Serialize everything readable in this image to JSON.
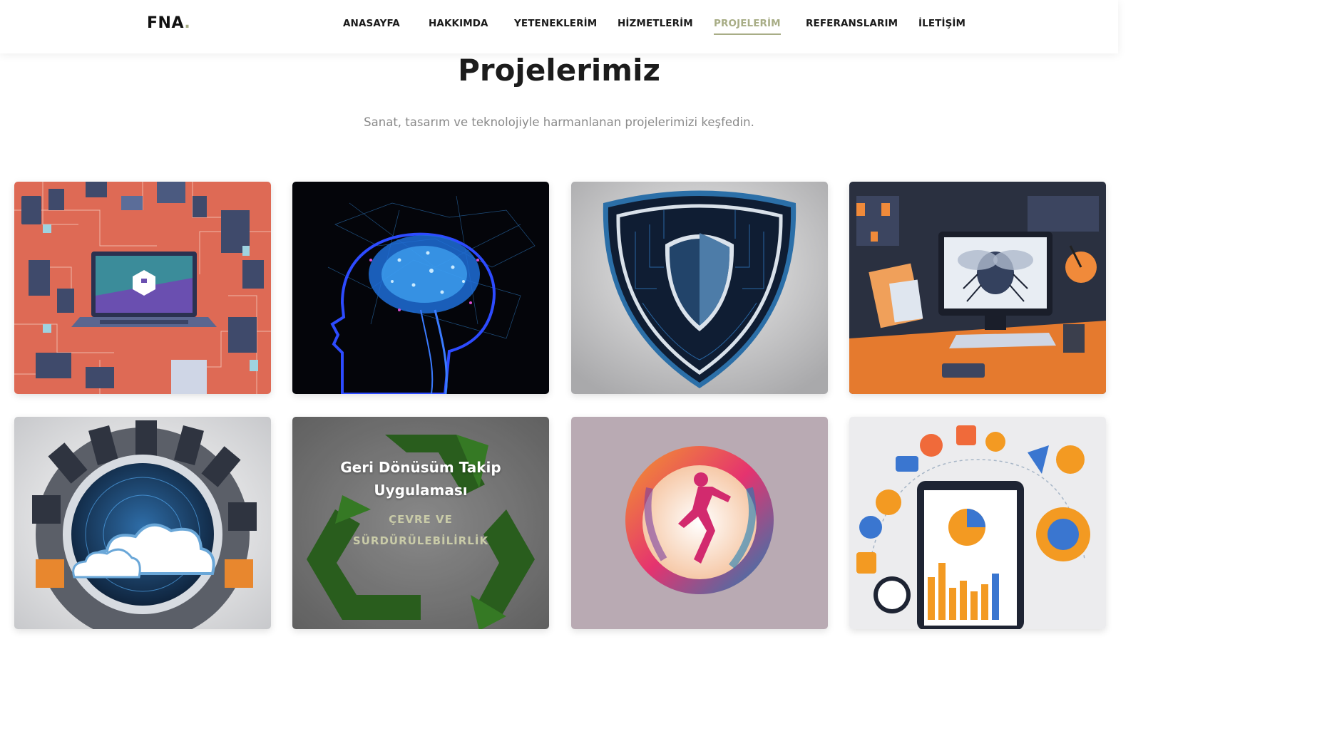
{
  "brand": {
    "name": "FNA",
    "dot": ".",
    "accent": "#a8ad86"
  },
  "nav": {
    "items": [
      {
        "label": "ANASAYFA",
        "active": false
      },
      {
        "label": "HAKKIMDA",
        "active": false
      },
      {
        "label": "YETENEKLERİM",
        "active": false
      },
      {
        "label": "HİZMETLERİM",
        "active": false
      },
      {
        "label": "PROJELERİM",
        "active": true
      },
      {
        "label": "REFERANSLARIM",
        "active": false
      },
      {
        "label": "İLETİŞİM",
        "active": false
      }
    ]
  },
  "section": {
    "title": "Projelerimiz",
    "subtitle": "Sanat, tasarım ve teknolojiyle harmanlanan projelerimizi keşfedin."
  },
  "projects": [
    {
      "image": "network-laptop-illustration"
    },
    {
      "image": "ai-brain-head-illustration"
    },
    {
      "image": "security-shield-illustration"
    },
    {
      "image": "bug-on-monitor-desk-illustration"
    },
    {
      "image": "cloud-server-ring-illustration"
    },
    {
      "image": "recycle-symbol-illustration",
      "title": "Geri Dönüsüm Takip Uygulaması",
      "category": "ÇEVRE VE SÜRDÜRÜLEBİLİRLİK"
    },
    {
      "image": "fitness-woman-circle-logo"
    },
    {
      "image": "analytics-tablet-icons-illustration"
    }
  ]
}
